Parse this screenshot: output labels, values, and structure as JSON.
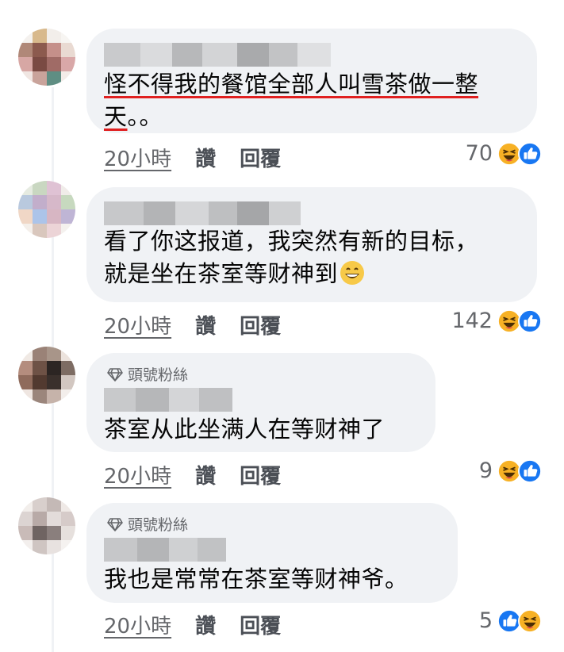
{
  "comments": [
    {
      "badge": "",
      "lines": [
        "怪不得我的餐馆全部人叫雪茶做一整",
        "天。。"
      ],
      "time": "20小時",
      "like": "讚",
      "reply": "回覆",
      "reaction_count": "70",
      "reactions": [
        "haha-icon",
        "like-icon"
      ]
    },
    {
      "badge": "",
      "lines": [
        "看了你这报道，我突然有新的目标，",
        "就是坐在茶室等财神到"
      ],
      "time": "20小時",
      "like": "讚",
      "reply": "回覆",
      "reaction_count": "142",
      "reactions": [
        "haha-icon",
        "like-icon"
      ]
    },
    {
      "badge": "頭號粉絲",
      "lines": [
        "茶室从此坐满人在等财神了"
      ],
      "time": "20小時",
      "like": "讚",
      "reply": "回覆",
      "reaction_count": "9",
      "reactions": [
        "haha-icon",
        "like-icon"
      ]
    },
    {
      "badge": "頭號粉絲",
      "lines": [
        "我也是常常在茶室等财神爷。"
      ],
      "time": "20小時",
      "like": "讚",
      "reply": "回覆",
      "reaction_count": "5",
      "reactions": [
        "like-icon",
        "haha-icon"
      ]
    }
  ],
  "colors": {
    "bubble": "#f0f2f5",
    "meta_text": "#65676b",
    "like_blue": "#1877f2",
    "haha_yellow": "#f7b125",
    "underline_red": "#e02020"
  }
}
